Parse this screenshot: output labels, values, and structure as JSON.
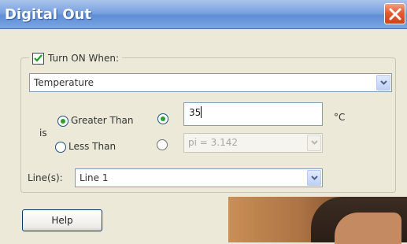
{
  "window": {
    "title": "Digital Out"
  },
  "turn_on": {
    "label": "Turn ON When:",
    "checked": true
  },
  "sensor": {
    "selected": "Temperature"
  },
  "condition": {
    "is_label": "is",
    "greater_than": "Greater Than",
    "less_than": "Less Than",
    "selected": "Greater Than"
  },
  "threshold": {
    "value": "35",
    "unit": "°C"
  },
  "constant": {
    "selected": "pi = 3.142"
  },
  "lines": {
    "label": "Line(s):",
    "selected": "Line 1"
  },
  "buttons": {
    "help": "Help"
  },
  "icons": {
    "close": "close-icon",
    "dropdown": "chevron-down-icon",
    "check": "checkmark-icon"
  },
  "colors": {
    "title_bar": "#6b97da",
    "close_button": "#e2582f",
    "radio_selected": "#2aa12a",
    "dialog_bg": "#ece9d8"
  }
}
